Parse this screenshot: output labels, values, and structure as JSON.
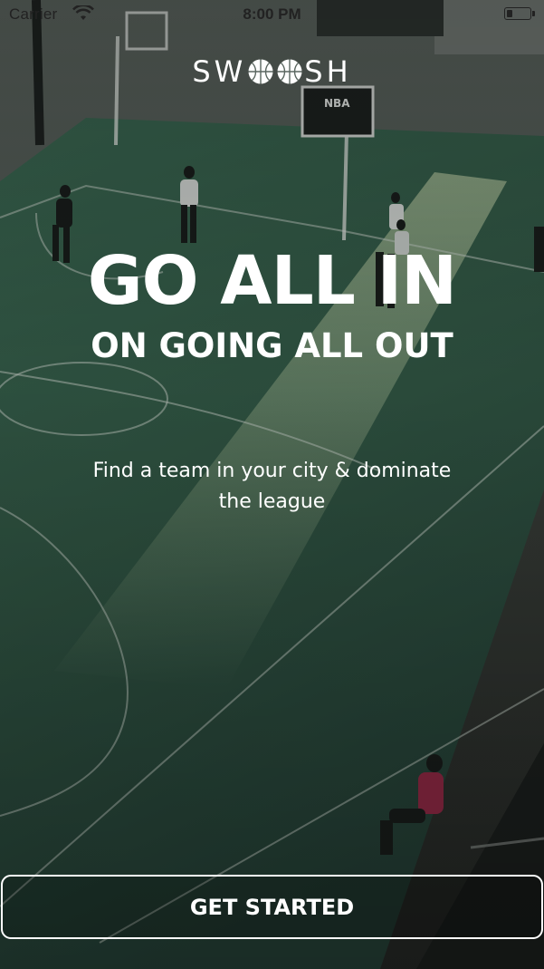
{
  "status_bar": {
    "carrier": "Carrier",
    "time": "8:00 PM",
    "icons": [
      "wifi-icon",
      "battery-icon"
    ]
  },
  "logo": {
    "prefix": "SW",
    "suffix": "SH",
    "icons": [
      "basketball-icon",
      "basketball-icon"
    ]
  },
  "hero": {
    "headline": "GO ALL IN",
    "subheadline": "ON GOING ALL OUT",
    "tagline": "Find a team in your city & dominate the league"
  },
  "actions": {
    "get_started_label": "GET STARTED"
  },
  "colors": {
    "court_green": "#3f6f55",
    "text": "#ffffff",
    "overlay": "#000000"
  }
}
